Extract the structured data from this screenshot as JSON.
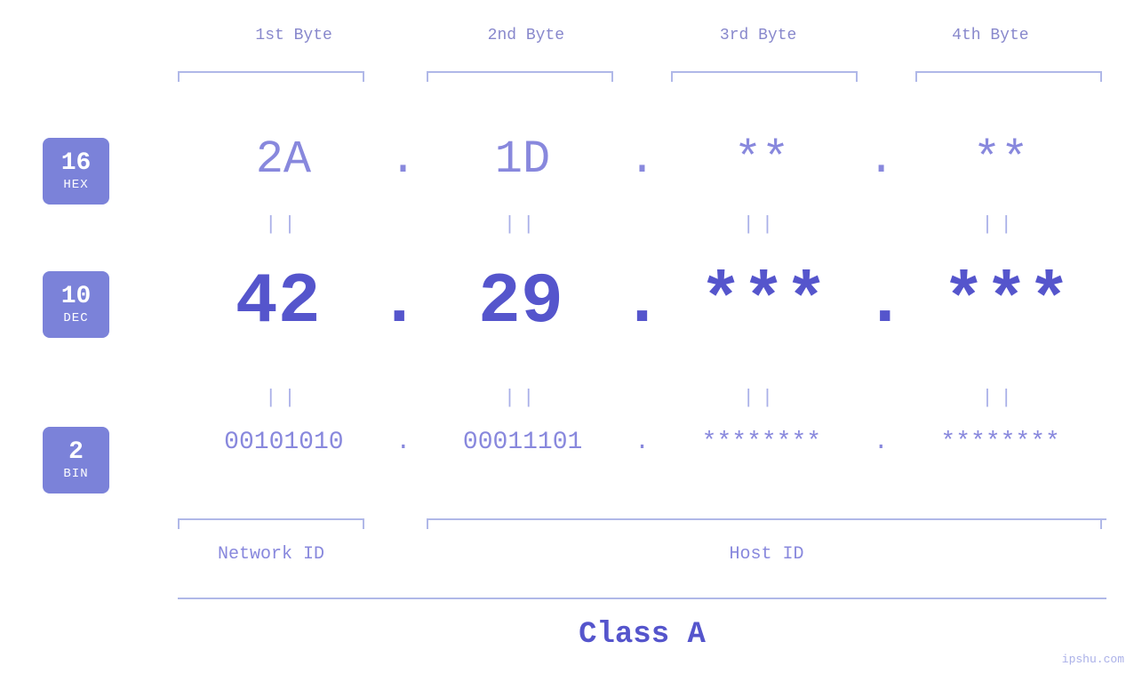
{
  "badges": {
    "hex": {
      "number": "16",
      "label": "HEX"
    },
    "dec": {
      "number": "10",
      "label": "DEC"
    },
    "bin": {
      "number": "2",
      "label": "BIN"
    }
  },
  "headers": {
    "byte1": "1st Byte",
    "byte2": "2nd Byte",
    "byte3": "3rd Byte",
    "byte4": "4th Byte"
  },
  "hex_row": {
    "b1": "2A",
    "b2": "1D",
    "b3": "**",
    "b4": "**",
    "dot": "."
  },
  "dec_row": {
    "b1": "42",
    "b2": "29",
    "b3": "***",
    "b4": "***",
    "dot": "."
  },
  "bin_row": {
    "b1": "00101010",
    "b2": "00011101",
    "b3": "********",
    "b4": "********",
    "dot": "."
  },
  "equals": {
    "sign": "||"
  },
  "labels": {
    "network_id": "Network ID",
    "host_id": "Host ID",
    "class": "Class A"
  },
  "watermark": "ipshu.com"
}
